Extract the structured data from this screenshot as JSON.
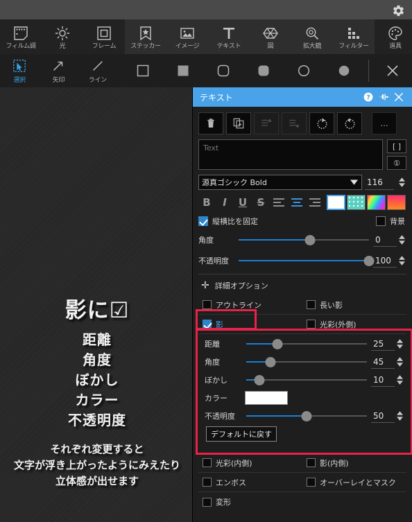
{
  "titlebar": {
    "gear_icon": "gear-icon"
  },
  "toolbar_main": {
    "groups": [
      {
        "items": [
          {
            "label": "フィルム調",
            "icon": "film-icon"
          },
          {
            "label": "光",
            "icon": "brightness-icon"
          },
          {
            "label": "フレーム",
            "icon": "frame-icon"
          }
        ]
      },
      {
        "items": [
          {
            "label": "ステッカー",
            "icon": "sticker-icon"
          },
          {
            "label": "イメージ",
            "icon": "image-icon"
          },
          {
            "label": "テキスト",
            "icon": "text-icon"
          },
          {
            "label": "図",
            "icon": "shape-icon"
          },
          {
            "label": "拡大鏡",
            "icon": "magnifier-icon"
          },
          {
            "label": "フィルター",
            "icon": "filter-icon"
          }
        ]
      },
      {
        "items": [
          {
            "label": "道具",
            "icon": "palette-icon"
          }
        ]
      }
    ]
  },
  "toolbar_sub": {
    "tools": [
      {
        "label": "選択",
        "icon": "select-icon",
        "active": true
      },
      {
        "label": "矢印",
        "icon": "arrow-icon",
        "active": false
      },
      {
        "label": "ライン",
        "icon": "line-icon",
        "active": false
      }
    ],
    "shapes": [
      "square-outline-icon",
      "square-filled-icon",
      "rounded-square-outline-icon",
      "rounded-square-filled-icon",
      "circle-outline-icon",
      "circle-filled-icon"
    ],
    "close_icon": "close-icon"
  },
  "canvas": {
    "heading": "影に☑",
    "list": [
      "距離",
      "角度",
      "ぼかし",
      "カラー",
      "不透明度"
    ],
    "footer": [
      "それぞれ変更すると",
      "文字が浮き上がったようにみえたり",
      "立体感が出せます"
    ]
  },
  "panel": {
    "title": "テキスト",
    "header_buttons": [
      "help-icon",
      "pin-icon",
      "close-icon"
    ],
    "tools": [
      {
        "name": "delete-icon",
        "disabled": false
      },
      {
        "name": "duplicate-icon",
        "disabled": false
      },
      {
        "name": "bring-forward-icon",
        "disabled": true
      },
      {
        "name": "send-backward-icon",
        "disabled": true
      },
      {
        "name": "rotate-left-icon",
        "disabled": false
      },
      {
        "name": "rotate-right-icon",
        "disabled": false
      },
      {
        "name": "more-icon",
        "disabled": false,
        "label": "..."
      }
    ],
    "text_value": "",
    "text_placeholder": "Text",
    "side_buttons": [
      "[  ]",
      "①"
    ],
    "font_name": "源真ゴシック Bold",
    "font_size": "116",
    "style_buttons": [
      "B",
      "I",
      "U",
      "S"
    ],
    "align_buttons": [
      "align-left-icon",
      "align-center-icon",
      "align-right-icon"
    ],
    "swatches": [
      {
        "name": "solid-white-swatch",
        "selected": true,
        "color": "#ffffff"
      },
      {
        "name": "pattern-swatch",
        "selected": false,
        "color": "#5ad0c0"
      },
      {
        "name": "rainbow-gradient-swatch",
        "selected": false,
        "color": "#ff5aa0"
      },
      {
        "name": "orange-gradient-swatch",
        "selected": false,
        "color": "#ff4070"
      }
    ],
    "aspect_lock_label": "縦横比を固定",
    "aspect_lock_checked": true,
    "background_label": "背景",
    "background_checked": false,
    "angle_label": "角度",
    "angle_value": "0",
    "angle_percent": 55,
    "opacity_label": "不透明度",
    "opacity_value": "100",
    "opacity_percent": 100,
    "advanced_label": "詳細オプション",
    "effects": [
      {
        "label": "アウトライン",
        "checked": false,
        "active": false
      },
      {
        "label": "長い影",
        "checked": false,
        "active": false
      },
      {
        "label": "影",
        "checked": true,
        "active": true
      },
      {
        "label": "光彩(外側)",
        "checked": false,
        "active": false
      },
      {
        "label": "光彩(内側)",
        "checked": false,
        "active": false
      },
      {
        "label": "影(内側)",
        "checked": false,
        "active": false
      },
      {
        "label": "エンボス",
        "checked": false,
        "active": false
      },
      {
        "label": "オーバーレイとマスク",
        "checked": false,
        "active": false
      },
      {
        "label": "変形",
        "checked": false,
        "active": false
      }
    ],
    "shadow": {
      "distance_label": "距離",
      "distance_value": "25",
      "distance_percent": 26,
      "angle_label": "角度",
      "angle_value": "45",
      "angle_percent": 20,
      "blur_label": "ぼかし",
      "blur_value": "10",
      "blur_percent": 11,
      "color_label": "カラー",
      "color_value": "#ffffff",
      "opacity_label": "不透明度",
      "opacity_value": "50",
      "opacity_percent": 50,
      "reset_label": "デフォルトに戻す"
    }
  },
  "colors": {
    "accent": "#4aa3e8",
    "highlight": "#e8234a",
    "slider_fill": "#1a7fd4",
    "panel_bg": "#1e1e1e"
  }
}
